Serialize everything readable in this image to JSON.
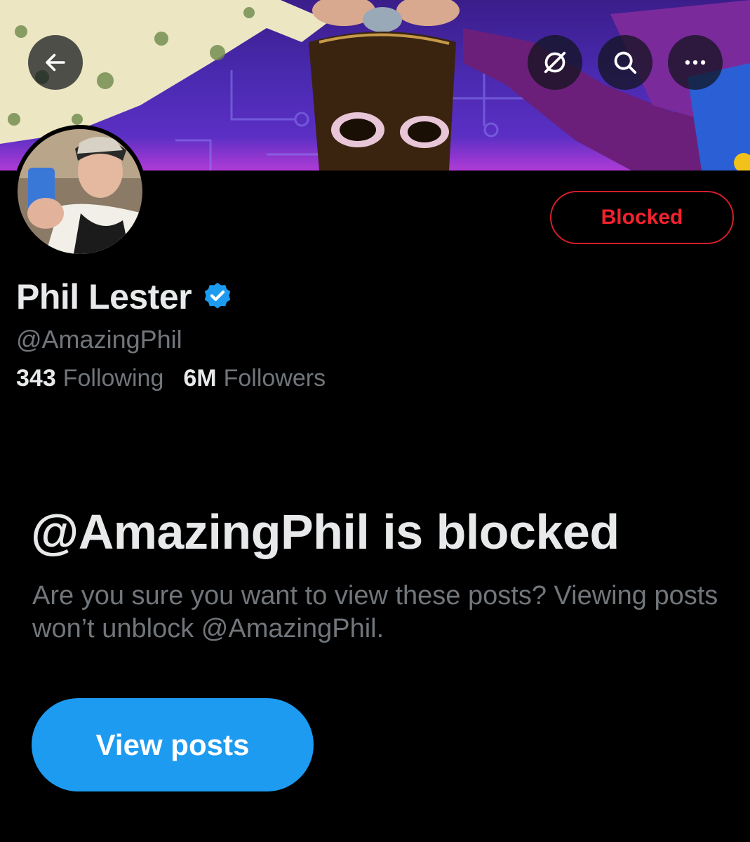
{
  "header": {
    "back_icon": "arrow-left-icon",
    "grok_icon": "grok-icon",
    "search_icon": "search-icon",
    "more_icon": "more-horizontal-icon"
  },
  "profile": {
    "display_name": "Phil Lester",
    "handle": "@AmazingPhil",
    "verified": true,
    "following_count": "343",
    "following_label": "Following",
    "followers_count": "6M",
    "followers_label": "Followers",
    "blocked_button_label": "Blocked"
  },
  "blocked_notice": {
    "title": "@AmazingPhil is blocked",
    "description": "Are you sure you want to view these posts? Viewing posts won’t unblock @AmazingPhil.",
    "button_label": "View posts"
  },
  "colors": {
    "background": "#000000",
    "accent": "#1d9bf0",
    "blocked_red": "#f4212e",
    "secondary_text": "#71767b"
  }
}
